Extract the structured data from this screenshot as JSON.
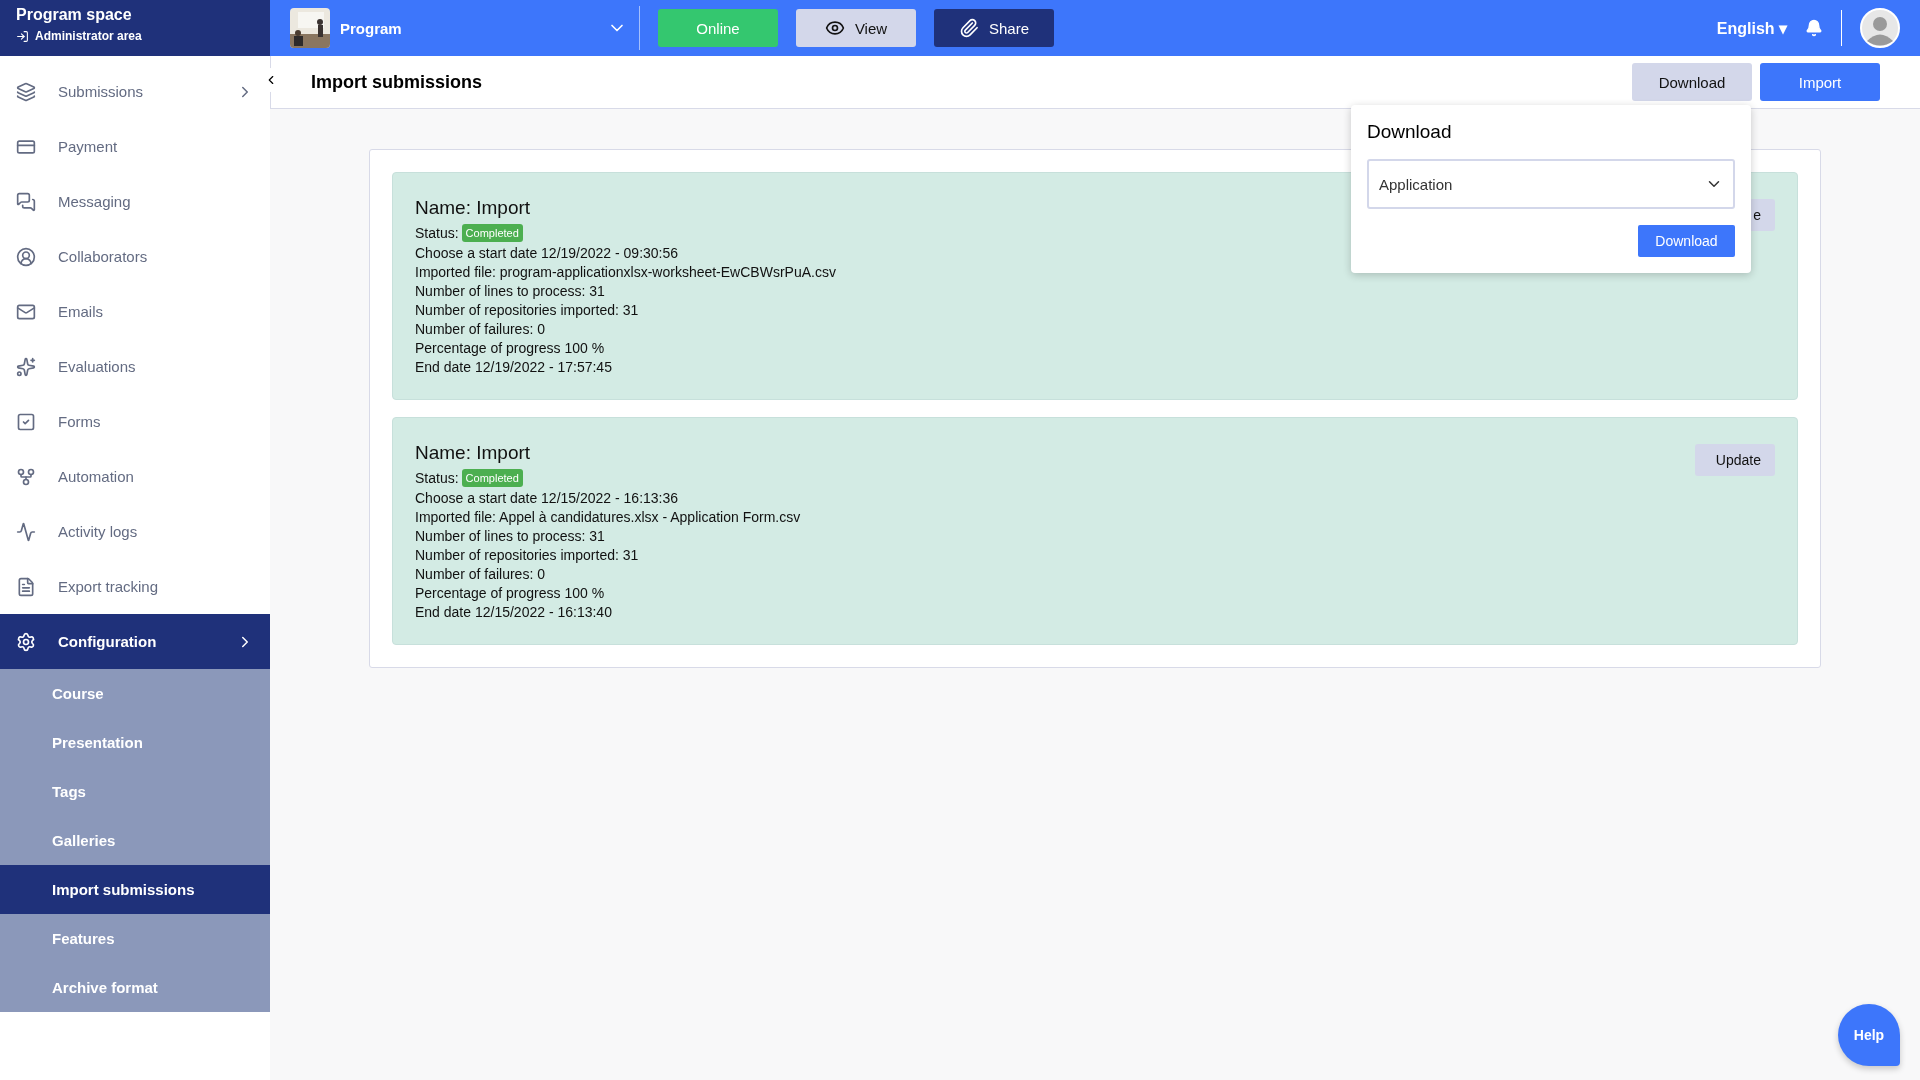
{
  "brand": {
    "title": "Program space",
    "subtitle": "Administrator area"
  },
  "topbar": {
    "program": "Program",
    "buttons": [
      {
        "kind": "status",
        "label": "Online"
      },
      {
        "kind": "view",
        "label": "View"
      },
      {
        "kind": "share",
        "label": "Share"
      }
    ],
    "language": "English",
    "language_caret": "▾"
  },
  "sidebar": {
    "items": [
      {
        "label": "Submissions",
        "chevron": true,
        "selected": false
      },
      {
        "label": "Payment",
        "chevron": false,
        "selected": false
      },
      {
        "label": "Messaging",
        "chevron": false,
        "selected": false
      },
      {
        "label": "Collaborators",
        "chevron": false,
        "selected": false
      },
      {
        "label": "Emails",
        "chevron": false,
        "selected": false
      },
      {
        "label": "Evaluations",
        "chevron": false,
        "selected": false
      },
      {
        "label": "Forms",
        "chevron": false,
        "selected": false
      },
      {
        "label": "Automation",
        "chevron": false,
        "selected": false
      },
      {
        "label": "Activity logs",
        "chevron": false,
        "selected": false
      },
      {
        "label": "Export tracking",
        "chevron": false,
        "selected": false
      },
      {
        "label": "Configuration",
        "chevron": true,
        "selected": true,
        "expanded": true,
        "children": [
          {
            "label": "Course",
            "selected": false
          },
          {
            "label": "Presentation",
            "selected": false
          },
          {
            "label": "Tags",
            "selected": false
          },
          {
            "label": "Galleries",
            "selected": false
          },
          {
            "label": "Import submissions",
            "selected": true
          },
          {
            "label": "Features",
            "selected": false
          },
          {
            "label": "Archive format",
            "selected": false
          }
        ]
      }
    ]
  },
  "header": {
    "title": "Import submissions",
    "buttons": [
      {
        "kind": "secondary",
        "label": "Download"
      },
      {
        "kind": "primary",
        "label": "Import"
      }
    ]
  },
  "imports": [
    {
      "name": "Name: Import",
      "status_label": "Status:",
      "status": "Completed",
      "update": "e",
      "lines": [
        "Choose a start date 12/19/2022 - 09:30:56",
        "Imported file: program-applicationxlsx-worksheet-EwCBWsrPuA.csv",
        "Number of lines to process: 31",
        "Number of repositories imported: 31",
        "Number of failures: 0",
        "Percentage of progress 100 %",
        "End date 12/19/2022 - 17:57:45"
      ]
    },
    {
      "name": "Name: Import",
      "status_label": "Status:",
      "status": "Completed",
      "update": "Update",
      "lines": [
        "Choose a start date 12/15/2022 - 16:13:36",
        "Imported file: Appel à candidatures.xlsx - Application Form.csv",
        "Number of lines to process: 31",
        "Number of repositories imported: 31",
        "Number of failures: 0",
        "Percentage of progress 100 %",
        "End date 12/15/2022 - 16:13:40"
      ]
    }
  ],
  "download_popover": {
    "title": "Download",
    "select_value": "Application",
    "button": "Download"
  },
  "help": "Help"
}
